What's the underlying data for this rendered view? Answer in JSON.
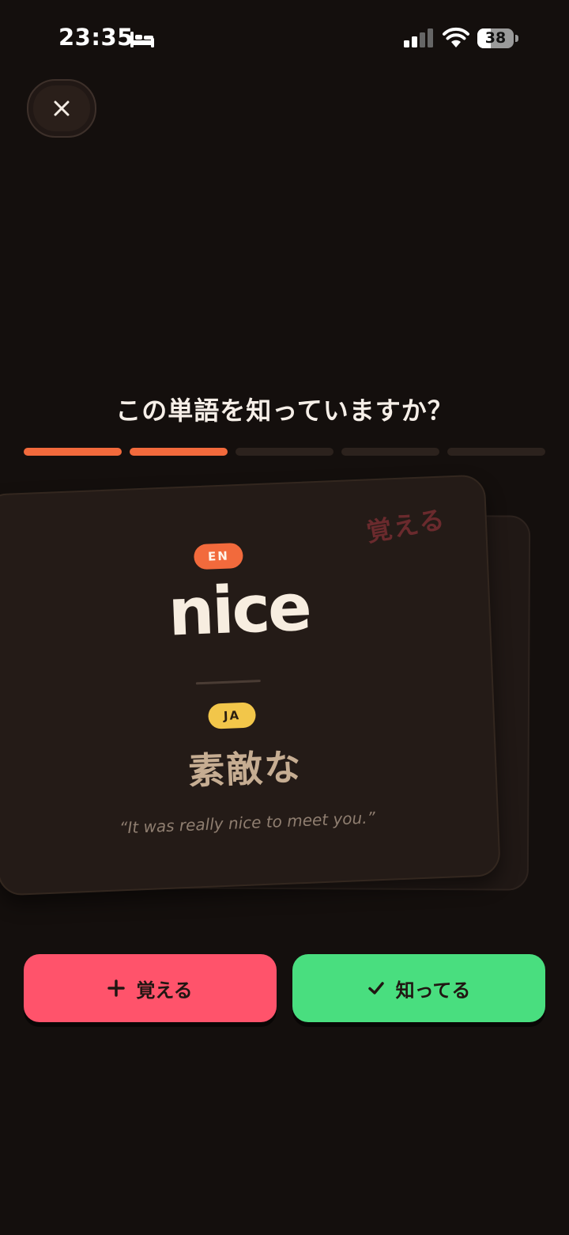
{
  "status_bar": {
    "time": "23:35",
    "battery_level": "38",
    "battery_fraction": 0.38,
    "icons": [
      "bed-icon",
      "cellular-signal-icon",
      "wifi-icon",
      "battery-icon"
    ]
  },
  "close_button": {
    "icon": "close-icon"
  },
  "question": "この単語を知っていますか？",
  "progress": {
    "completed": 2,
    "total": 5,
    "accent": "#f26a3c"
  },
  "card": {
    "stamp": "覚える",
    "source_lang": "EN",
    "word": "nice",
    "target_lang": "JA",
    "translation": "素敵な",
    "example": "“It was really nice to meet you.”"
  },
  "actions": {
    "learn_label": "覚える",
    "learn_icon": "plus-icon",
    "learn_color": "#ff536b",
    "know_label": "知ってる",
    "know_icon": "check-icon",
    "know_color": "#49de7f"
  }
}
